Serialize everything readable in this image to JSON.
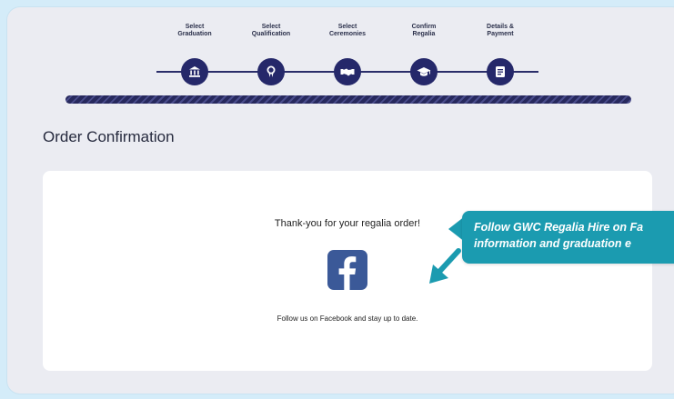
{
  "steps": [
    {
      "line1": "Select",
      "line2": "Graduation",
      "icon": "bank-icon"
    },
    {
      "line1": "Select",
      "line2": "Qualification",
      "icon": "certificate-icon"
    },
    {
      "line1": "Select",
      "line2": "Ceremonies",
      "icon": "handshake-icon"
    },
    {
      "line1": "Confirm",
      "line2": "Regalia",
      "icon": "graduation-cap-icon"
    },
    {
      "line1": "Details &",
      "line2": "Payment",
      "icon": "document-icon"
    }
  ],
  "page": {
    "title": "Order Confirmation"
  },
  "card": {
    "thanks": "Thank-you for your regalia order!",
    "follow": "Follow us on Facebook and stay up to date.",
    "logo_icon": "facebook-icon"
  },
  "callout": {
    "line1": "Follow GWC Regalia Hire on Fa",
    "line2": "information and graduation e"
  },
  "colors": {
    "step_fill": "#25286a",
    "progress": "#27295e",
    "facebook": "#3b5998",
    "callout": "#1b9bb0",
    "background": "#ebecf2"
  }
}
